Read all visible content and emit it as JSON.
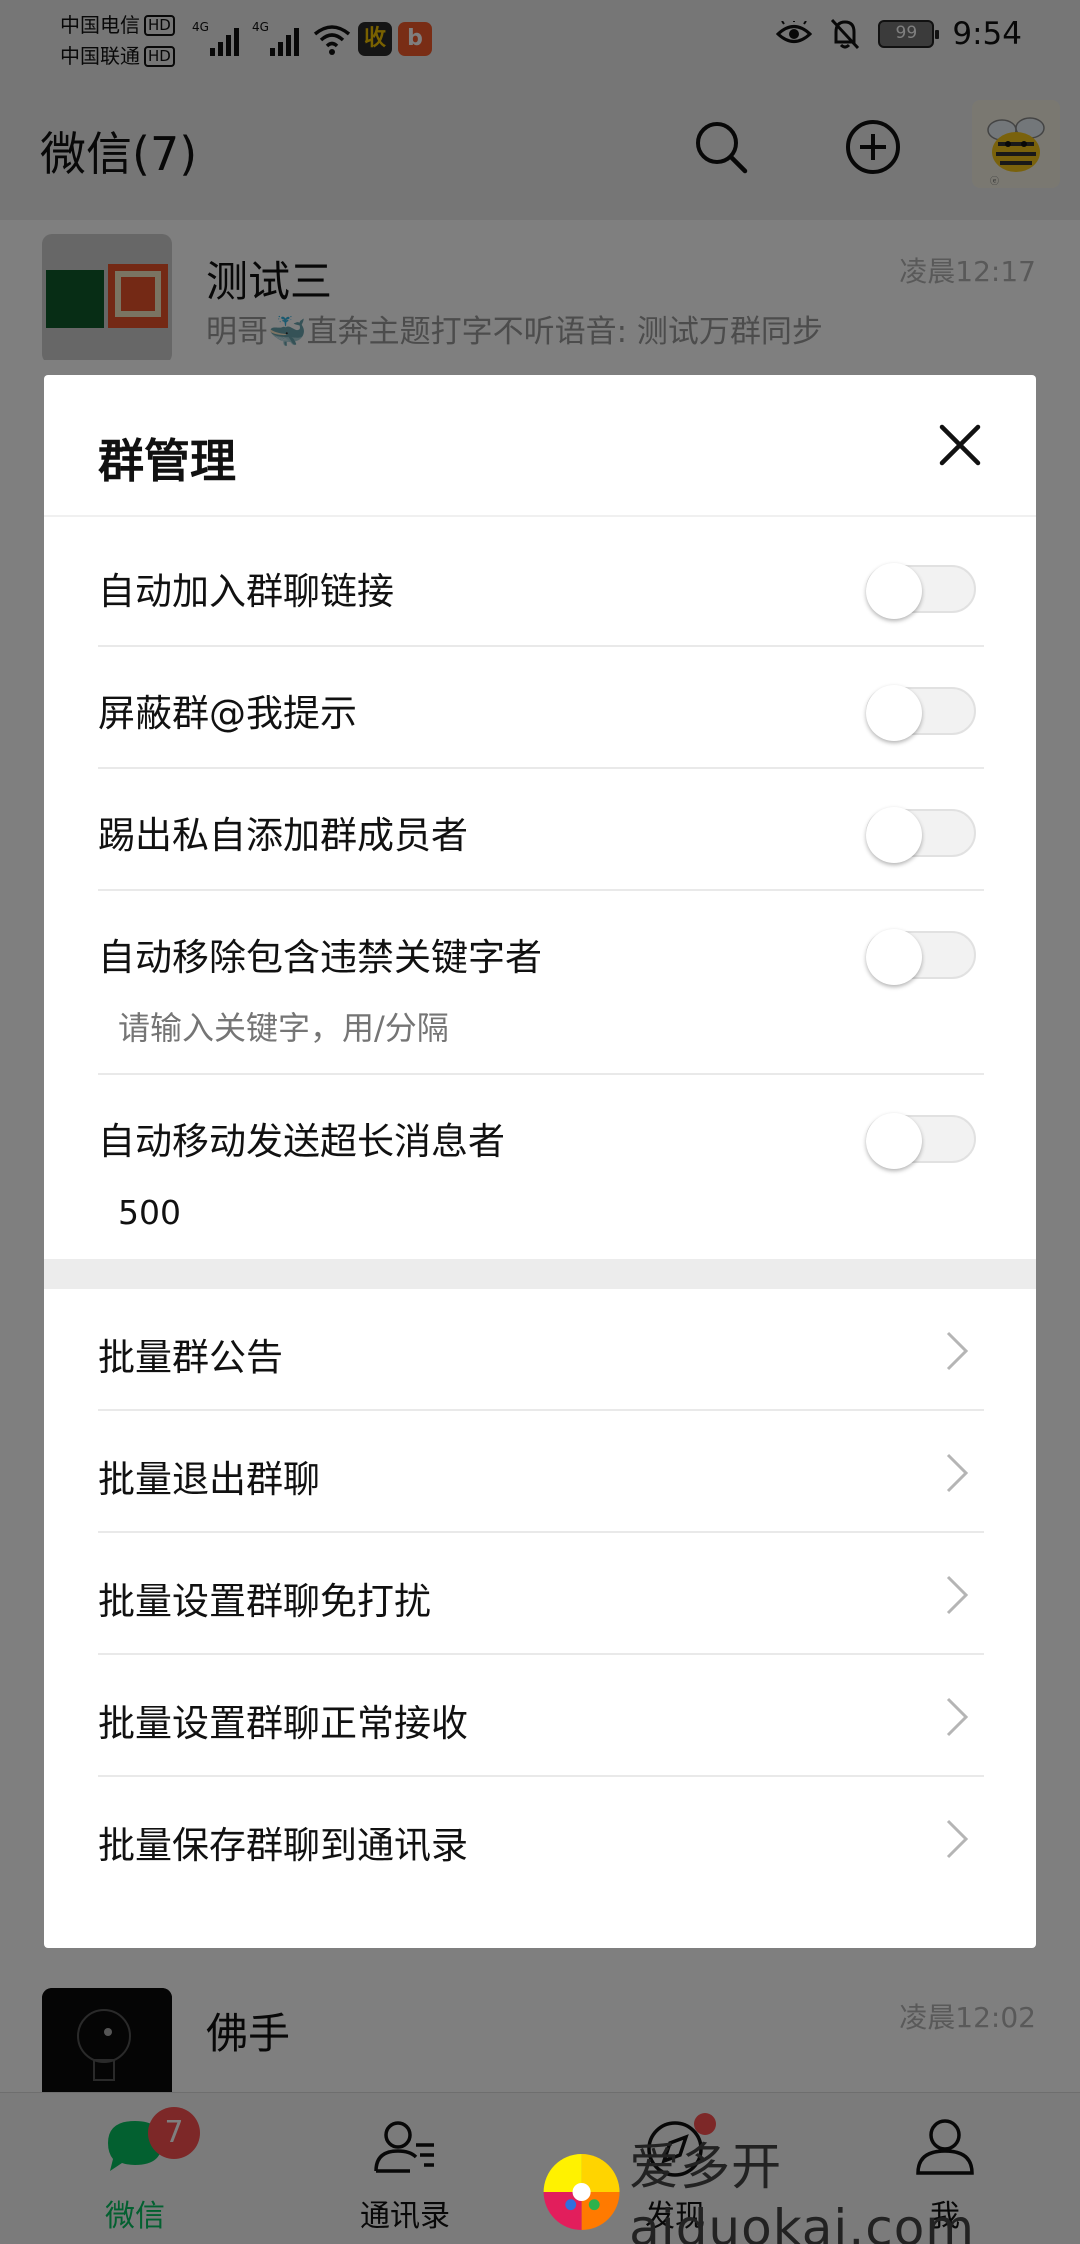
{
  "status_bar": {
    "carrier_1": "中国电信",
    "carrier_2": "中国联通",
    "hd_badge": "HD",
    "network_1": "4G",
    "network_2": "4G",
    "battery_level": "99",
    "time": "9:54"
  },
  "header": {
    "title": "微信(7)"
  },
  "chats": [
    {
      "name": "测试三",
      "time": "凌晨12:17",
      "snippet": "明哥🐳直奔主题打字不听语音: 测试万群同步"
    },
    {
      "name": "佛手",
      "time": "凌晨12:02",
      "snippet": ""
    }
  ],
  "modal": {
    "title": "群管理",
    "toggles": [
      {
        "label": "自动加入群聊链接",
        "on": false
      },
      {
        "label": "屏蔽群@我提示",
        "on": false
      },
      {
        "label": "踢出私自添加群成员者",
        "on": false
      },
      {
        "label": "自动移除包含违禁关键字者",
        "on": false,
        "input_placeholder": "请输入关键字，用/分隔"
      },
      {
        "label": "自动移动发送超长消息者",
        "on": false,
        "input_value": "500"
      }
    ],
    "actions": [
      "批量群公告",
      "批量退出群聊",
      "批量设置群聊免打扰",
      "批量设置群聊正常接收",
      "批量保存群聊到通讯录"
    ]
  },
  "tabs": [
    {
      "label": "微信",
      "badge": "7",
      "active": true
    },
    {
      "label": "通讯录"
    },
    {
      "label": "发现",
      "dot": true
    },
    {
      "label": "我"
    }
  ],
  "watermark": "爱多开aiduokai.com",
  "colors": {
    "active_green": "#07c160",
    "badge_red": "#fa5151"
  }
}
